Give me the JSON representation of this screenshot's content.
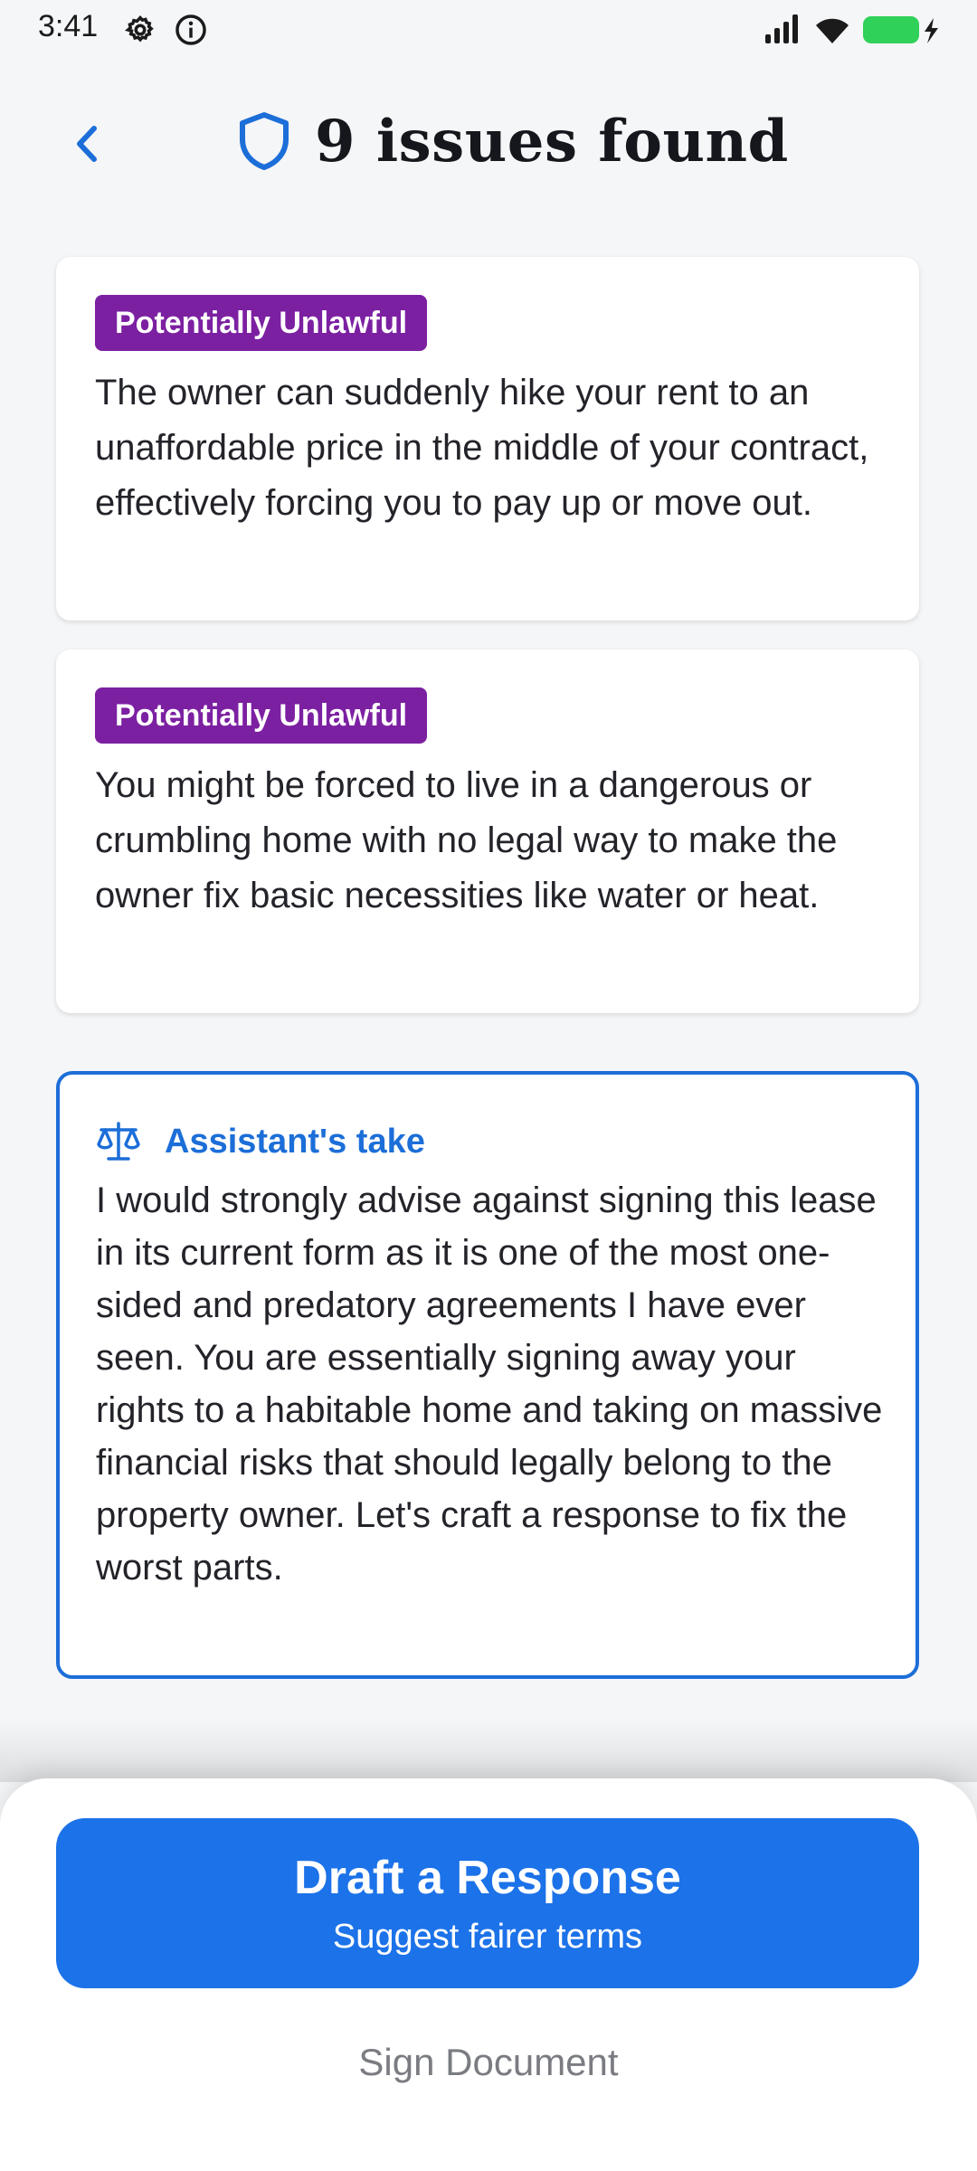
{
  "status_bar": {
    "time": "3:41",
    "icons": [
      "settings-icon",
      "info-icon",
      "cellular-signal-icon",
      "wifi-icon",
      "battery-charging-icon"
    ]
  },
  "header": {
    "title": "9 issues found",
    "back_icon": "chevron-left-icon",
    "shield_icon": "shield-icon"
  },
  "issues": [
    {
      "badge": "Potentially Unlawful",
      "text": "The owner can suddenly hike your rent to an unaffordable price in the middle of your contract, effectively forcing you to pay up or move out."
    },
    {
      "badge": "Potentially Unlawful",
      "text": "You might be forced to live in a dangerous or crumbling home with no legal way to make the owner fix basic necessities like water or heat."
    }
  ],
  "assistant": {
    "icon": "scale-icon",
    "title": "Assistant's take",
    "text": "I would strongly advise against signing this lease in its current form as it is one of the most one-sided and predatory agreements I have ever seen. You are essentially signing away your rights to a habitable home and taking on massive financial risks that should legally belong to the property owner. Let's craft a response to fix the worst parts."
  },
  "actions": {
    "primary_label": "Draft a Response",
    "primary_sub": "Suggest fairer terms",
    "secondary_label": "Sign Document"
  },
  "colors": {
    "accent": "#1C72E8",
    "badge": "#7C20A2",
    "background": "#F5F6F8",
    "battery": "#2FD158"
  }
}
